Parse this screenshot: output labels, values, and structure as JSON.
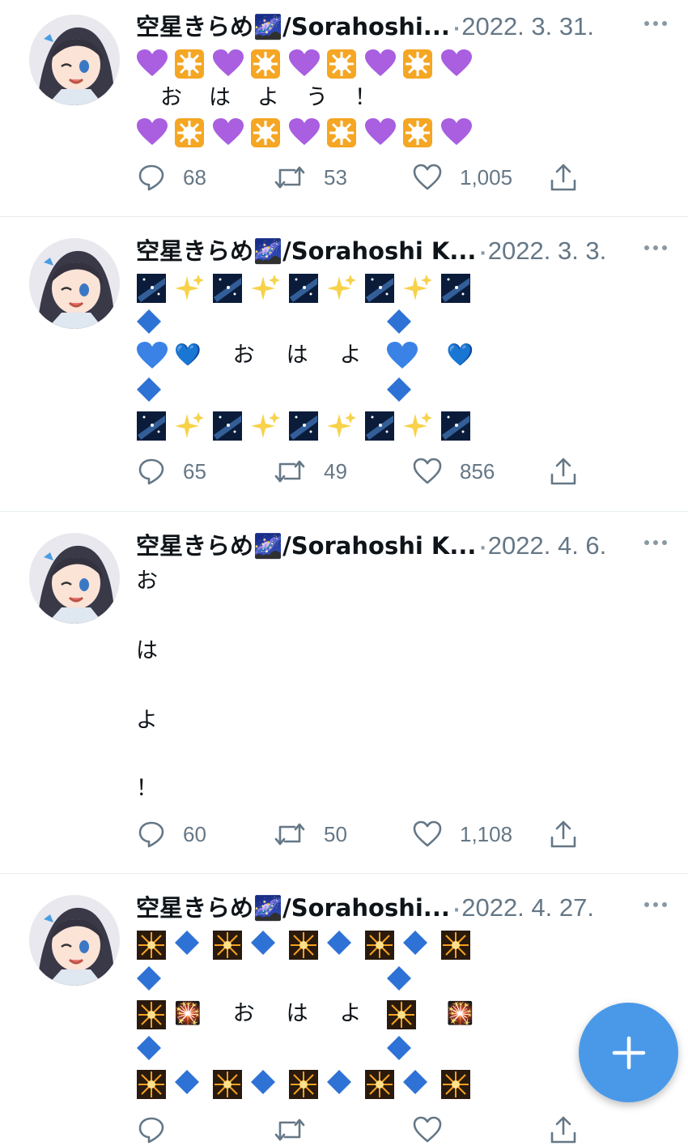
{
  "colors": {
    "accent": "#4a99e9",
    "muted": "#657786",
    "divider": "#e6ecf0",
    "text": "#0f1419"
  },
  "tweets": [
    {
      "author": "空星きらめ🌌/Sorahoshi...",
      "date": "2022. 3. 31.",
      "lines": [
        "💜🔆💜🔆💜🔆💜🔆💜",
        "　お　は　よ　う　！",
        "💜🔆💜🔆💜🔆💜🔆💜"
      ],
      "replies": "68",
      "retweets": "53",
      "likes": "1,005"
    },
    {
      "author": "空星きらめ🌌/Sorahoshi K...",
      "date": "2022. 3. 3.",
      "lines": [
        "🌌✨🌌✨🌌✨🌌✨🌌",
        "🔷　　　　　　🔷",
        "💙　お　は　よ　！　💙",
        "🔷　　　　　　🔷",
        "🌌✨🌌✨🌌✨🌌✨🌌"
      ],
      "replies": "65",
      "retweets": "49",
      "likes": "856"
    },
    {
      "author": "空星きらめ🌌/Sorahoshi K...",
      "date": "2022. 4. 6.",
      "lines": [
        "お",
        "",
        "は",
        "",
        "よ",
        "",
        "！"
      ],
      "replies": "60",
      "retweets": "50",
      "likes": "1,108"
    },
    {
      "author": "空星きらめ🌌/Sorahoshi...",
      "date": "2022. 4. 27.",
      "lines": [
        "🎇🔷🎇🔷🎇🔷🎇🔷🎇",
        "🔷　　　　　　🔷",
        "🎇　お　は　よ　！　🎇",
        "🔷　　　　　　🔷",
        "🎇🔷🎇🔷🎇🔷🎇🔷🎇"
      ]
    }
  ],
  "fab": {
    "icon": "plus-icon"
  }
}
